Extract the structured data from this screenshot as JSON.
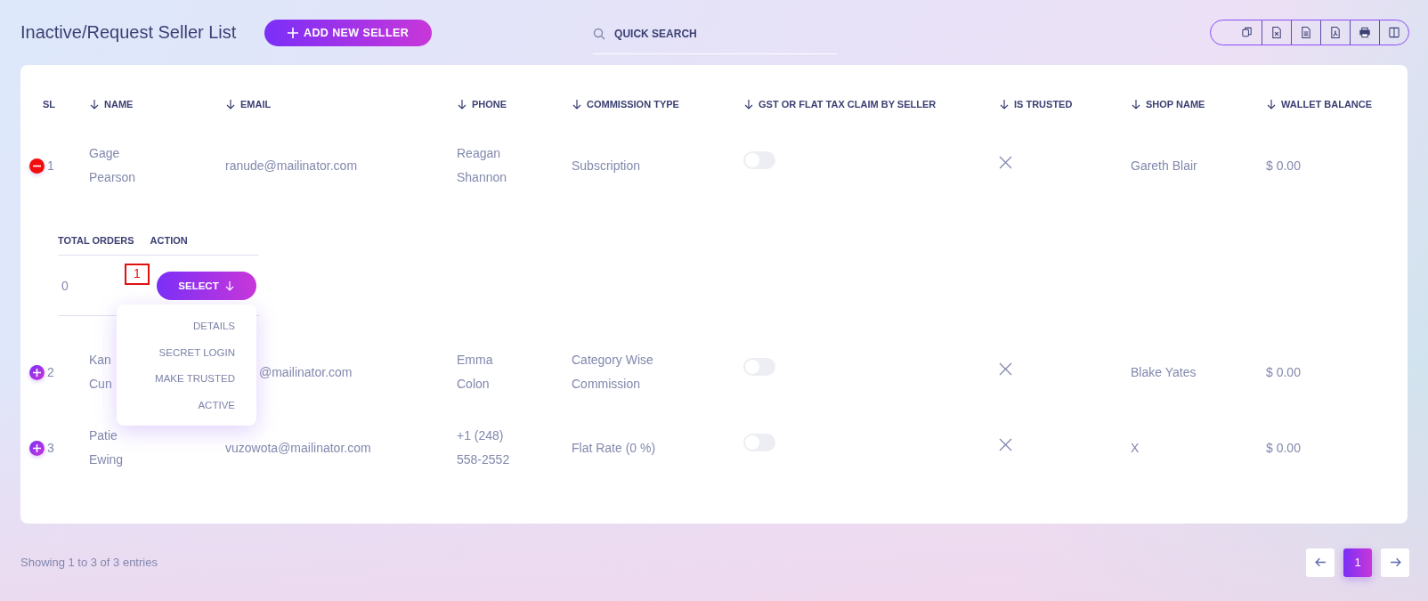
{
  "header": {
    "title": "Inactive/Request Seller List",
    "add_button": "ADD NEW SELLER",
    "search": {
      "placeholder": "QUICK SEARCH"
    }
  },
  "table": {
    "columns": [
      {
        "label": "SL",
        "sortable": false
      },
      {
        "label": "NAME",
        "sortable": true
      },
      {
        "label": "EMAIL",
        "sortable": true
      },
      {
        "label": "PHONE",
        "sortable": true
      },
      {
        "label": "COMMISSION TYPE",
        "sortable": true
      },
      {
        "label": "GST OR FLAT TAX CLAIM BY SELLER",
        "sortable": true
      },
      {
        "label": "IS TRUSTED",
        "sortable": true
      },
      {
        "label": "SHOP NAME",
        "sortable": true
      },
      {
        "label": "WALLET BALANCE",
        "sortable": true
      }
    ],
    "rows": [
      {
        "expanded": true,
        "sl": "1",
        "name": [
          "Gage",
          "Pearson"
        ],
        "email": "ranude@mailinator.com",
        "phone": [
          "Reagan",
          "Shannon"
        ],
        "commission": [
          "Subscription"
        ],
        "gst_on": false,
        "trusted": false,
        "shop": "Gareth Blair",
        "wallet": "$ 0.00",
        "details": {
          "columns": [
            "TOTAL ORDERS",
            "ACTION"
          ],
          "total_orders": "0",
          "action_button": "SELECT",
          "annotation": "1",
          "menu": {
            "open": true,
            "items": [
              "DETAILS",
              "SECRET LOGIN",
              "MAKE TRUSTED",
              "ACTIVE"
            ]
          }
        }
      },
      {
        "expanded": false,
        "sl": "2",
        "name": [
          "Kan",
          "Cun"
        ],
        "email": "@mailinator.com",
        "phone": [
          "Emma",
          "Colon"
        ],
        "commission": [
          "Category Wise",
          "Commission"
        ],
        "gst_on": false,
        "trusted": false,
        "shop": "Blake Yates",
        "wallet": "$ 0.00"
      },
      {
        "expanded": false,
        "sl": "3",
        "name": [
          "Patie",
          "Ewing"
        ],
        "email": "vuzowota@mailinator.com",
        "phone": [
          "+1 (248)",
          "558-2552"
        ],
        "commission": [
          "Flat Rate (0 %)"
        ],
        "gst_on": false,
        "trusted": false,
        "shop": "X",
        "wallet": "$ 0.00"
      }
    ]
  },
  "footer": {
    "summary": "Showing 1 to 3 of 3 entries",
    "pages": [
      {
        "label": "1",
        "selected": true
      }
    ]
  }
}
